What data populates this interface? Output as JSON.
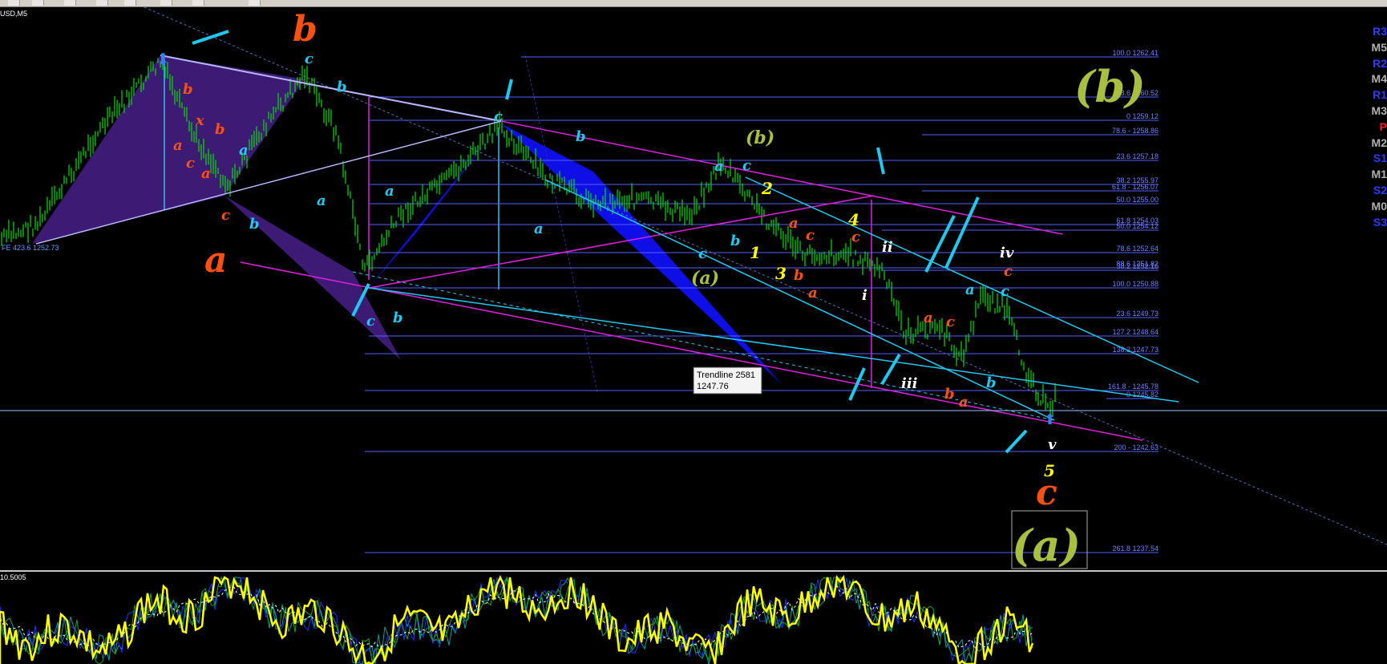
{
  "chart_title": "USD,M5",
  "indicator_label": "10.5005",
  "fe_label": "FE 423.6 1252.73",
  "trendline_tooltip": {
    "name": "Trendline 2581",
    "value": "1247.76"
  },
  "fib_left": [
    {
      "label": "100.0 1262.41",
      "color": "#5560ff"
    },
    {
      "label": "88.6 1260.52",
      "color": "#5560ff"
    },
    {
      "label": "0 1259.12",
      "color": "#5560ff"
    },
    {
      "label": "23.6 1257.18",
      "color": "#5560ff"
    },
    {
      "label": "38.2 1255.97",
      "color": "#5560ff"
    },
    {
      "label": "50.0 1255.00",
      "color": "#5560ff"
    },
    {
      "label": "61.8 1254.03",
      "color": "#5560ff"
    },
    {
      "label": "78.6 1252.64",
      "color": "#5560ff"
    },
    {
      "label": "88.6 1251.82",
      "color": "#5560ff"
    },
    {
      "label": "100.0 1250.88",
      "color": "#5560ff"
    },
    {
      "label": "127.2 1248.64",
      "color": "#5560ff"
    },
    {
      "label": "138.2 1247.73",
      "color": "#5560ff"
    },
    {
      "label": "161.8 - 1245.78",
      "color": "#5560ff"
    },
    {
      "label": "200 - 1242.63",
      "color": "#5560ff"
    },
    {
      "label": "261.8 1237.54",
      "color": "#5560ff"
    }
  ],
  "fib_right": [
    {
      "label": "78.6 - 1258.86"
    },
    {
      "label": "61.8 - 1256.07"
    },
    {
      "label": "50.0 1254.12"
    },
    {
      "label": "38.2 1252.16"
    },
    {
      "label": "23.6 1249.73"
    },
    {
      "label": "0 1245.82"
    }
  ],
  "pivots": [
    {
      "label": "R3",
      "color": "#2b3cff"
    },
    {
      "label": "M5",
      "color": "#b0b0b0"
    },
    {
      "label": "R2",
      "color": "#2b3cff"
    },
    {
      "label": "M4",
      "color": "#b0b0b0"
    },
    {
      "label": "R1",
      "color": "#2b3cff"
    },
    {
      "label": "M3",
      "color": "#b0b0b0"
    },
    {
      "label": "P",
      "color": "#ff2020"
    },
    {
      "label": "M2",
      "color": "#b0b0b0"
    },
    {
      "label": "S1",
      "color": "#2b3cff"
    },
    {
      "label": "M1",
      "color": "#b0b0b0"
    },
    {
      "label": "S2",
      "color": "#2b3cff"
    },
    {
      "label": "M0",
      "color": "#b0b0b0"
    },
    {
      "label": "S3",
      "color": "#2b3cff"
    }
  ],
  "wave_labels": {
    "big_b_top": "b",
    "big_a_left": "a",
    "big_c_bottom": "c",
    "paren_b_right": "(b)",
    "paren_a_bottom": "(a)",
    "paren_b_mid": "(b)",
    "paren_a_mid": "(a)",
    "c": "c",
    "b": "b",
    "a": "a",
    "x": "x",
    "n1": "1",
    "n2": "2",
    "n3": "3",
    "n4": "4",
    "n5": "5",
    "i": "i",
    "ii": "ii",
    "iii": "iii",
    "iv": "iv",
    "v": "v"
  },
  "colors": {
    "background": "#000000",
    "candles": "#00e000",
    "fib_lines": "#5560ff",
    "magenta": "#e020e0",
    "cyan": "#20c8f0",
    "orange": "#ff5010",
    "olive": "#a8c040",
    "yellow": "#ffff00",
    "harmonic_blue": "#1010ff",
    "harmonic_purple": "#48208a"
  }
}
